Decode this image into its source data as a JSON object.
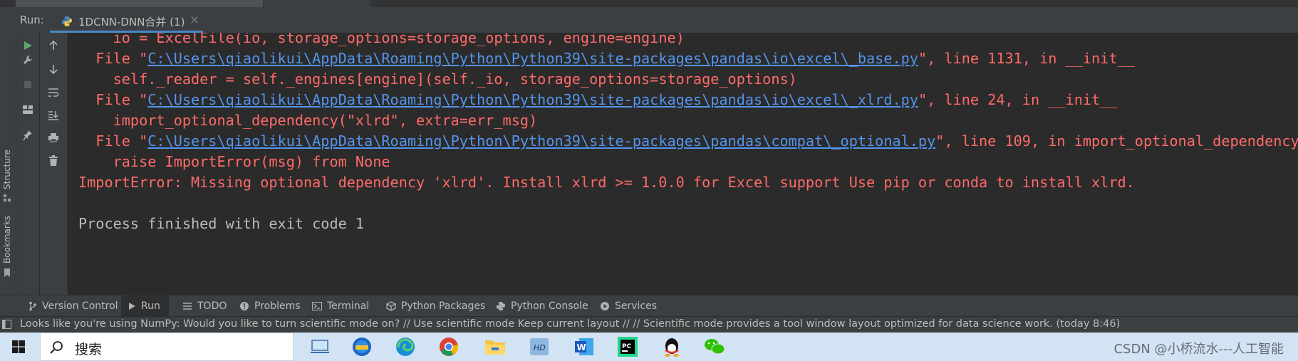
{
  "run_bar": {
    "label": "Run:",
    "tab_title": "1DCNN-DNN合并 (1)",
    "close": "×"
  },
  "side_labels": {
    "structure": "Structure",
    "bookmarks": "Bookmarks"
  },
  "console": {
    "lines": [
      {
        "indent": "    ",
        "text": "io = ExcelFile(io, storage_options=storage_options, engine=engine)"
      },
      {
        "prefix": "  File \"",
        "link": "C:\\Users\\qiaolikui\\AppData\\Roaming\\Python\\Python39\\site-packages\\pandas\\io\\excel\\_base.py",
        "suffix": "\", line 1131, in __init__"
      },
      {
        "indent": "    ",
        "text": "self._reader = self._engines[engine](self._io, storage_options=storage_options)"
      },
      {
        "prefix": "  File \"",
        "link": "C:\\Users\\qiaolikui\\AppData\\Roaming\\Python\\Python39\\site-packages\\pandas\\io\\excel\\_xlrd.py",
        "suffix": "\", line 24, in __init__"
      },
      {
        "indent": "    ",
        "text": "import_optional_dependency(\"xlrd\", extra=err_msg)"
      },
      {
        "prefix": "  File \"",
        "link": "C:\\Users\\qiaolikui\\AppData\\Roaming\\Python\\Python39\\site-packages\\pandas\\compat\\_optional.py",
        "suffix": "\", line 109, in import_optional_dependency"
      },
      {
        "indent": "    ",
        "text": "raise ImportError(msg) from None"
      },
      {
        "indent": "",
        "text": "ImportError: Missing optional dependency 'xlrd'. Install xlrd >= 1.0.0 for Excel support Use pip or conda to install xlrd."
      },
      {
        "indent": "",
        "text": "Process finished with exit code 1"
      }
    ]
  },
  "bottom_tabs": [
    "Version Control",
    "Run",
    "TODO",
    "Problems",
    "Terminal",
    "Python Packages",
    "Python Console",
    "Services"
  ],
  "status": {
    "message": "Looks like you're using NumPy: Would you like to turn scientific mode on? // Use scientific mode   Keep current layout // // Scientific mode provides a tool window layout optimized for data science work. (today 8:46)"
  },
  "taskbar": {
    "search_placeholder": "搜索",
    "watermark": "CSDN @小桥流水---人工智能",
    "apps": [
      "task-view",
      "network-app",
      "edge",
      "chrome",
      "file-explorer",
      "hdd-tool",
      "word",
      "pycharm",
      "qq",
      "wechat"
    ]
  },
  "colors": {
    "error_text": "#ff6b68",
    "link": "#5394ec",
    "normal_text": "#bbbbbb",
    "editor_bg": "#2b2b2b",
    "panel_bg": "#3c3f41",
    "taskbar_bg": "#d2e3f3",
    "tab_underline": "#4a88c7"
  }
}
